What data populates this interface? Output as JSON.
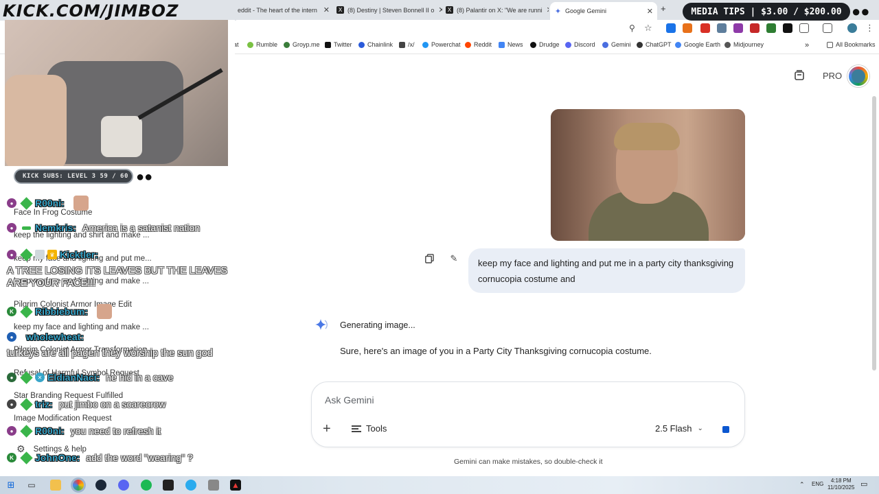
{
  "browser": {
    "tabs": [
      {
        "label": "eddit - The heart of the intern",
        "icon": "reddit-icon"
      },
      {
        "label": "(8) Destiny | Steven Bonnell II o",
        "icon": "x-icon"
      },
      {
        "label": "(8) Palantir on X: \"We are runni",
        "icon": "x-icon"
      },
      {
        "label": "Google Gemini",
        "icon": "gemini-icon"
      }
    ],
    "new_tab": "+",
    "close": "✕"
  },
  "bookmarks": [
    {
      "label": "Rumble",
      "color": "#7ac143"
    },
    {
      "label": "Groyp.me",
      "color": "#3a7d3a"
    },
    {
      "label": "Twitter",
      "color": "#111111"
    },
    {
      "label": "Chainlink",
      "color": "#2a5ada"
    },
    {
      "label": "/x/",
      "color": "#444444"
    },
    {
      "label": "Powerchat",
      "color": "#2196f3"
    },
    {
      "label": "Reddit",
      "color": "#ff4500"
    },
    {
      "label": "News",
      "color": "#4285f4"
    },
    {
      "label": "Drudge",
      "color": "#111111"
    },
    {
      "label": "Discord",
      "color": "#5865f2"
    },
    {
      "label": "Gemini",
      "color": "#4a6ee0"
    },
    {
      "label": "ChatGPT",
      "color": "#333333"
    },
    {
      "label": "Google Earth",
      "color": "#4285f4"
    },
    {
      "label": "Midjourney",
      "color": "#555555"
    }
  ],
  "bookmarks_extra": {
    "partial": "at",
    "all_bookmarks": "All Bookmarks",
    "more": "»"
  },
  "gemini": {
    "pro_label": "PRO",
    "user_message": "keep my face and lighting and put me in a party city thanksgiving cornucopia costume and",
    "generating": "Generating image...",
    "reply": "Sure, here's an image of you in a Party City Thanksgiving cornucopia costume.",
    "prompt_placeholder": "Ask Gemini",
    "tools_label": "Tools",
    "model_label": "2.5 Flash",
    "disclaimer": "Gemini can make mistakes, so double-check it"
  },
  "overlay": {
    "logo": "KICK.COM/JIMBOZ",
    "subs": "KICK SUBS: LEVEL 3 59 / 60",
    "media_tips": "MEDIA TIPS | $3.00 / $200.00"
  },
  "chat": [
    {
      "user": "R00ni:",
      "text": "",
      "top": 0
    },
    {
      "user": "Nemkris:",
      "text": "America is a satanist nation"
    },
    {
      "user": "Kicktler:",
      "text": ""
    },
    {
      "user": "Ribbiebum:",
      "text": ""
    },
    {
      "user": "wholewheat:",
      "text": ""
    },
    {
      "user": "EldianNaci:",
      "text": "he hid in a cave"
    },
    {
      "user": "triz:",
      "text": "put jimbo on a scarecrow"
    },
    {
      "user": "R00ni:",
      "text": "you need to refresh it"
    },
    {
      "user": "JohnOne:",
      "text": "add the word \"wearing\" ?"
    }
  ],
  "chat_overlays": {
    "tree": "A TREE LOSING ITS LEAVES BUT THE LEAVES",
    "tree2": "ARE YOUR FACE!!!",
    "turkeys": "turkeys are all pagen they worship the sun god"
  },
  "sidebar_history": [
    "Face In Frog Costume",
    "keep the lighting and shirt and make ...",
    "keep my face and lighting and put me...",
    "keep my face and lighting and make ...",
    "Pilgrim Colonist Armor Image Edit",
    "keep my face and lighting and make ...",
    "Pilgrim Colonist Armor Transformation",
    "Refusal of Harmful Symbol Request",
    "Star Branding Request Fulfilled",
    "Image Modification Request"
  ],
  "sidebar_settings": "Settings & help",
  "taskbar": {
    "lang": "ENG",
    "time": "4:18 PM",
    "date": "11/10/2025"
  },
  "colors": {
    "accent": "#0b57d0",
    "bubble": "#e9eef6",
    "chat_user": "#38a5c9"
  }
}
